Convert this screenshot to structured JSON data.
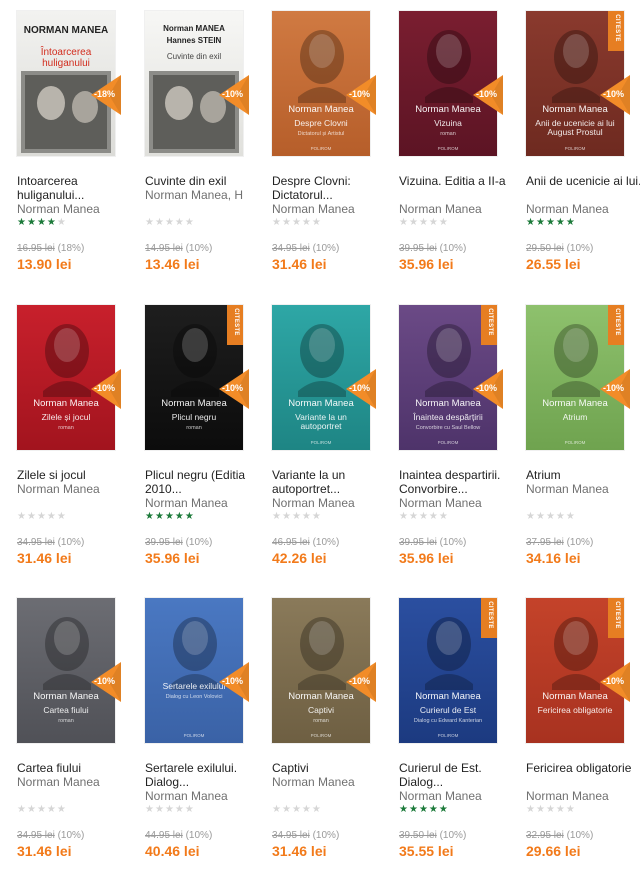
{
  "colors": {
    "price": "#f27a1a",
    "star_on": "#1c7a3a",
    "star_off": "#d6d6d6",
    "badge": "#f28c28",
    "ribbon": "#e67e22"
  },
  "products": [
    {
      "title": "Intoarcerea huliganului...",
      "author": "Norman Manea",
      "rating": 4,
      "old_price": "16.95 lei",
      "discount": "(18%)",
      "price": "13.90 lei",
      "badge": "-18%",
      "ribbon": "",
      "cover": {
        "author": "NORMAN MANEA",
        "title": "Întoarcerea huliganului",
        "subtitle": "",
        "publisher": "",
        "style": "white",
        "colors": [
          "#f2f2f0",
          "#dcdcd8"
        ]
      }
    },
    {
      "title": "Cuvinte din exil",
      "author": "Norman Manea, H",
      "rating": 0,
      "old_price": "14.95 lei",
      "discount": "(10%)",
      "price": "13.46 lei",
      "badge": "-10%",
      "ribbon": "",
      "cover": {
        "author": "Norman MANEA",
        "author2": "Hannes STEIN",
        "title": "Cuvinte din exil",
        "subtitle": "",
        "publisher": "",
        "style": "white",
        "colors": [
          "#f7f7f5",
          "#e0e0dc"
        ]
      }
    },
    {
      "title": "Despre Clovni: Dictatorul...",
      "author": "Norman Manea",
      "rating": 0,
      "old_price": "34.95 lei",
      "discount": "(10%)",
      "price": "31.46 lei",
      "badge": "-10%",
      "ribbon": "",
      "cover": {
        "author": "Norman Manea",
        "title": "Despre Clovni",
        "subtitle": "Dictatorul și Artistul",
        "publisher": "POLIROM",
        "style": "dark",
        "colors": [
          "#d07a42",
          "#b65e2a"
        ]
      }
    },
    {
      "title": "Vizuina. Editia a II-a",
      "author": "Norman Manea",
      "rating": 0,
      "old_price": "39.95 lei",
      "discount": "(10%)",
      "price": "35.96 lei",
      "badge": "-10%",
      "ribbon": "",
      "cover": {
        "author": "Norman Manea",
        "title": "Vizuina",
        "subtitle": "roman",
        "publisher": "POLIROM",
        "style": "dark",
        "colors": [
          "#7a1e30",
          "#5c1424"
        ]
      }
    },
    {
      "title": "Anii de ucenicie ai lui...",
      "author": "Norman Manea",
      "rating": 5,
      "old_price": "29.50 lei",
      "discount": "(10%)",
      "price": "26.55 lei",
      "badge": "-10%",
      "ribbon": "CITESTE",
      "cover": {
        "author": "Norman Manea",
        "title": "Anii de ucenicie ai lui August Prostul",
        "subtitle": "",
        "publisher": "POLIROM",
        "style": "dark",
        "colors": [
          "#8a3a2e",
          "#6e2a20"
        ]
      }
    },
    {
      "title": "Zilele si jocul",
      "author": "Norman Manea",
      "rating": 0,
      "old_price": "34.95 lei",
      "discount": "(10%)",
      "price": "31.46 lei",
      "badge": "-10%",
      "ribbon": "",
      "cover": {
        "author": "Norman Manea",
        "title": "Zilele și jocul",
        "subtitle": "roman",
        "publisher": "",
        "style": "dark",
        "colors": [
          "#c8202c",
          "#a2141e"
        ]
      }
    },
    {
      "title": "Plicul negru (Editia 2010...",
      "author": "Norman Manea",
      "rating": 5,
      "old_price": "39.95 lei",
      "discount": "(10%)",
      "price": "35.96 lei",
      "badge": "-10%",
      "ribbon": "CITESTE",
      "cover": {
        "author": "Norman Manea",
        "title": "Plicul negru",
        "subtitle": "roman",
        "publisher": "",
        "style": "dark",
        "colors": [
          "#1e1e1e",
          "#0c0c0c"
        ]
      }
    },
    {
      "title": "Variante la un autoportret...",
      "author": "Norman Manea",
      "rating": 0,
      "old_price": "46.95 lei",
      "discount": "(10%)",
      "price": "42.26 lei",
      "badge": "-10%",
      "ribbon": "",
      "cover": {
        "author": "Norman Manea",
        "title": "Variante la un autoportret",
        "subtitle": "",
        "publisher": "POLIROM",
        "style": "dark",
        "colors": [
          "#2ea7a6",
          "#1e8584"
        ]
      }
    },
    {
      "title": "Inaintea despartirii. Convorbire...",
      "author": "Norman Manea",
      "rating": 0,
      "old_price": "39.95 lei",
      "discount": "(10%)",
      "price": "35.96 lei",
      "badge": "-10%",
      "ribbon": "CITESTE",
      "cover": {
        "author": "Norman Manea",
        "title": "Înaintea despărțirii",
        "subtitle": "Convorbire cu Saul Bellow",
        "publisher": "POLIROM",
        "style": "dark",
        "colors": [
          "#6b4a86",
          "#4e336a"
        ]
      }
    },
    {
      "title": "Atrium",
      "author": "Norman Manea",
      "rating": 0,
      "old_price": "37.95 lei",
      "discount": "(10%)",
      "price": "34.16 lei",
      "badge": "-10%",
      "ribbon": "CITESTE",
      "cover": {
        "author": "Norman Manea",
        "title": "Atrium",
        "subtitle": "",
        "publisher": "POLIROM",
        "style": "dark",
        "colors": [
          "#8ec16d",
          "#6fa34f"
        ]
      }
    },
    {
      "title": "Cartea fiului",
      "author": "Norman Manea",
      "rating": 0,
      "old_price": "34.95 lei",
      "discount": "(10%)",
      "price": "31.46 lei",
      "badge": "-10%",
      "ribbon": "",
      "cover": {
        "author": "Norman Manea",
        "title": "Cartea fiului",
        "subtitle": "roman",
        "publisher": "",
        "style": "dark",
        "colors": [
          "#6c6d73",
          "#505157"
        ]
      }
    },
    {
      "title": "Sertarele exilului. Dialog...",
      "author": "Norman Manea",
      "rating": 0,
      "old_price": "44.95 lei",
      "discount": "(10%)",
      "price": "40.46 lei",
      "badge": "-10%",
      "ribbon": "",
      "cover": {
        "author": "",
        "title": "Sertarele exilului",
        "subtitle": "Dialog cu Leon Volovici",
        "publisher": "POLIROM",
        "style": "dark",
        "colors": [
          "#4a78c2",
          "#3a62a6"
        ]
      }
    },
    {
      "title": "Captivi",
      "author": "Norman Manea",
      "rating": 0,
      "old_price": "34.95 lei",
      "discount": "(10%)",
      "price": "31.46 lei",
      "badge": "-10%",
      "ribbon": "",
      "cover": {
        "author": "Norman Manea",
        "title": "Captivi",
        "subtitle": "roman",
        "publisher": "POLIROM",
        "style": "dark",
        "colors": [
          "#8a7a5a",
          "#6e5f42"
        ]
      }
    },
    {
      "title": "Curierul de Est. Dialog...",
      "author": "Norman Manea",
      "rating": 5,
      "old_price": "39.50 lei",
      "discount": "(10%)",
      "price": "35.55 lei",
      "badge": "",
      "ribbon": "CITESTE",
      "cover": {
        "author": "Norman Manea",
        "title": "Curierul de Est",
        "subtitle": "Dialog cu Edward Kanterian",
        "publisher": "POLIROM",
        "style": "dark",
        "colors": [
          "#2b4fa0",
          "#1c3a80"
        ]
      }
    },
    {
      "title": "Fericirea obligatorie",
      "author": "Norman Manea",
      "rating": 0,
      "old_price": "32.95 lei",
      "discount": "(10%)",
      "price": "29.66 lei",
      "badge": "-10%",
      "ribbon": "CITESTE",
      "cover": {
        "author": "Norman Manea",
        "title": "Fericirea obligatorie",
        "subtitle": "",
        "publisher": "",
        "style": "dark",
        "colors": [
          "#c4432a",
          "#a83220"
        ]
      }
    }
  ]
}
